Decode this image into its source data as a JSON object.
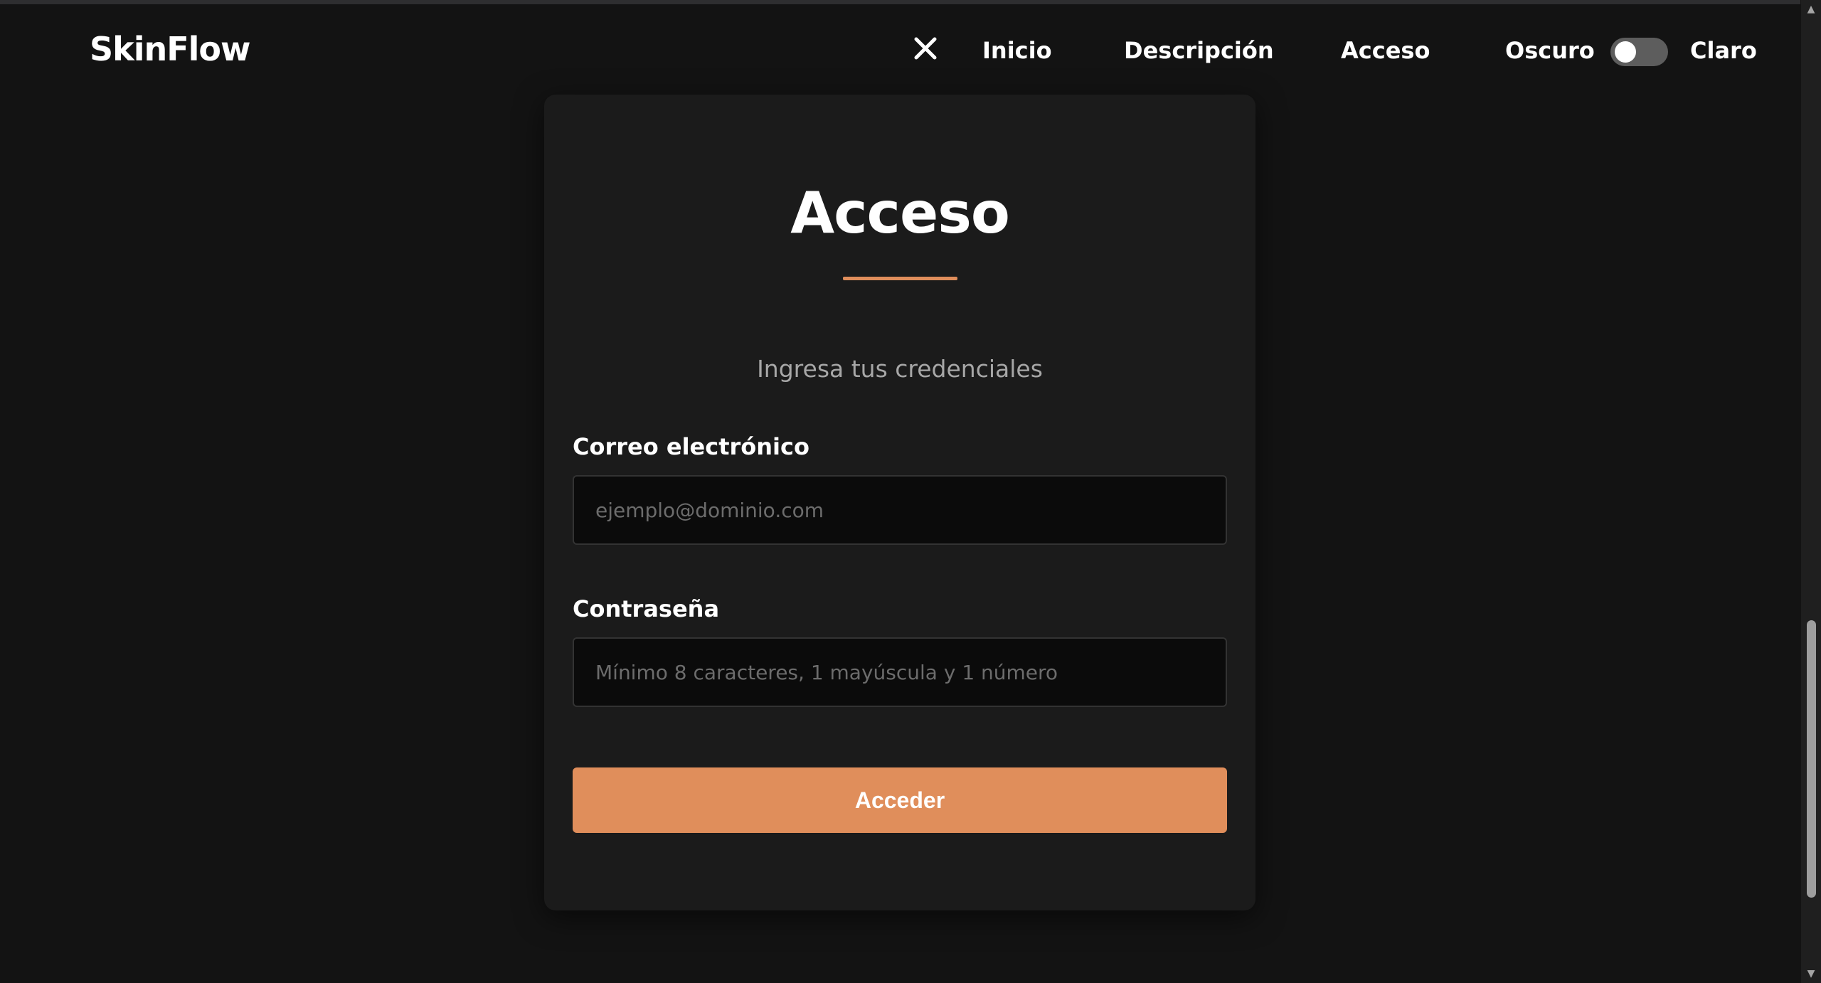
{
  "header": {
    "logo": "SkinFlow",
    "close_icon": "close-icon",
    "nav": {
      "inicio": "Inicio",
      "descripcion": "Descripción",
      "acceso": "Acceso"
    },
    "theme": {
      "dark_label": "Oscuro",
      "light_label": "Claro",
      "toggle_state": "off"
    }
  },
  "login": {
    "title": "Acceso",
    "subtitle": "Ingresa tus credenciales",
    "email": {
      "label": "Correo electrónico",
      "placeholder": "ejemplo@dominio.com",
      "value": ""
    },
    "password": {
      "label": "Contraseña",
      "placeholder": "Mínimo 8 caracteres, 1 mayúscula y 1 número",
      "value": ""
    },
    "submit_label": "Acceder"
  },
  "colors": {
    "background": "#131313",
    "card": "#1b1b1b",
    "accent": "#e08e5b",
    "input_bg": "#0b0b0b",
    "muted_text": "#a7a7a7"
  },
  "icons": {
    "close": "close-icon",
    "scroll_up": "scroll-up-arrow-icon",
    "scroll_down": "scroll-down-arrow-icon"
  }
}
